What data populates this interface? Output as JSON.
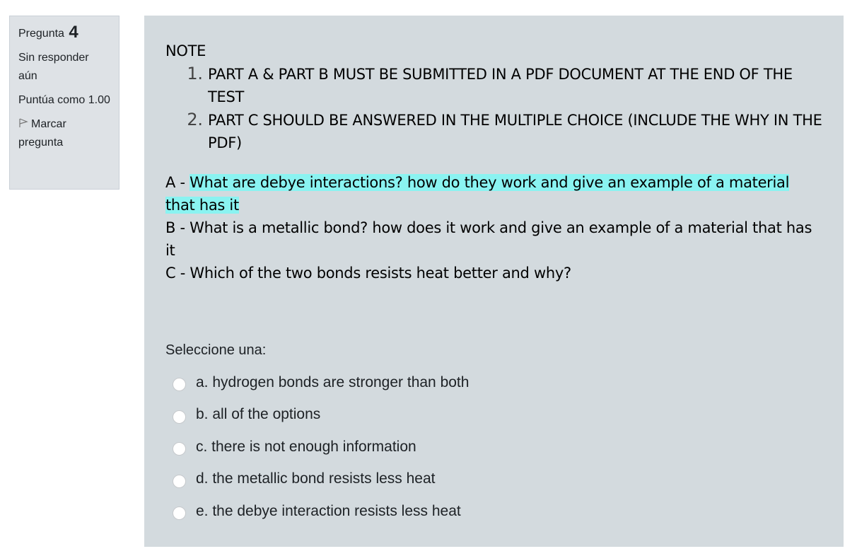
{
  "question_info": {
    "label": "Pregunta",
    "number": "4",
    "state": "Sin responder aún",
    "grade": "Puntúa como 1.00",
    "flag_label": "Marcar pregunta",
    "flag_icon": "flag-icon"
  },
  "question": {
    "note_title": "NOTE",
    "notes": [
      "PART A & PART B MUST BE SUBMITTED IN A PDF DOCUMENT AT THE END OF THE TEST",
      "PART C SHOULD BE ANSWERED IN THE MULTIPLE CHOICE (INCLUDE THE WHY IN THE PDF)"
    ],
    "part_a_prefix": "A - ",
    "part_a_text": "What are debye interactions? how do they work and give an example of a material that has it",
    "part_b": "B - What is a metallic  bond? how does it work and give an example of a material that has it",
    "part_c": "C - Which of the two bonds resists heat better and why?"
  },
  "answer_prompt": "Seleccione una:",
  "answers": [
    {
      "label": "a. hydrogen bonds are stronger than both",
      "selected": false
    },
    {
      "label": "b. all of the options",
      "selected": false
    },
    {
      "label": "c. there is not enough information",
      "selected": false
    },
    {
      "label": "d. the metallic bond resists less heat",
      "selected": false
    },
    {
      "label": "e. the debye interaction resists less heat",
      "selected": false
    }
  ],
  "colors": {
    "info_bg": "#dee2e6",
    "content_bg": "#d3dade",
    "highlight": "#8af3f1"
  }
}
